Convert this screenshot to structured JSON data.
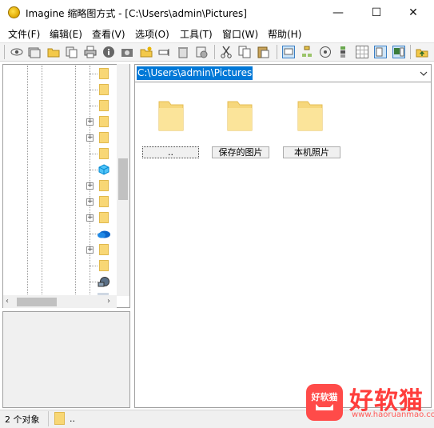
{
  "window": {
    "title": "Imagine 缩略图方式 - [C:\\Users\\admin\\Pictures]",
    "buttons": {
      "minimize": "—",
      "maximize": "☐",
      "close": "✕"
    }
  },
  "menu": [
    "文件(F)",
    "编辑(E)",
    "查看(V)",
    "选项(O)",
    "工具(T)",
    "窗口(W)",
    "帮助(H)"
  ],
  "toolbar": {
    "icons": [
      "view-icon",
      "slideshow-icon",
      "open-folder-icon",
      "copy-to-icon",
      "print-icon",
      "info-icon",
      "camera-icon",
      "new-folder-icon",
      "rename-icon",
      "delete-icon",
      "batch-icon",
      "cut-icon",
      "copy-icon",
      "paste-icon",
      "thumbnail-view-icon",
      "tree-icon",
      "refresh-icon",
      "filter-icon",
      "grid-icon",
      "preview-icon",
      "panel-icon",
      "up-folder-icon"
    ]
  },
  "address": {
    "path": "C:\\Users\\admin\\Pictures"
  },
  "files": [
    {
      "label": "..",
      "selected": true
    },
    {
      "label": "保存的图片",
      "selected": false
    },
    {
      "label": "本机照片",
      "selected": false
    }
  ],
  "status": {
    "count": "2 个对象",
    "path": ".."
  },
  "watermark": {
    "logo": "好软猫",
    "name": "好软猫",
    "url": "www.haoruanmao.com"
  },
  "colors": {
    "selection": "#0078d7",
    "folder": "#f8d775",
    "watermark": "#ff3d3b"
  }
}
